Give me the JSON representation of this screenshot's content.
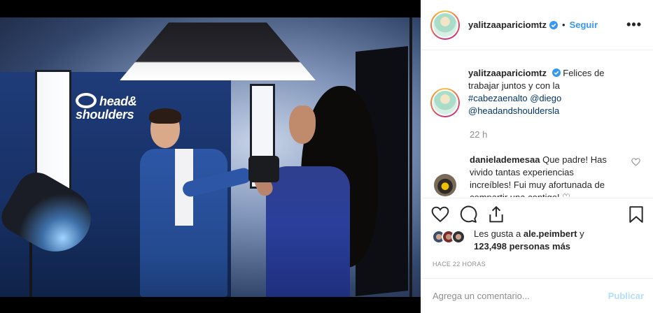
{
  "post": {
    "author": {
      "username": "yalitzaapariciomtz",
      "verified": true,
      "follow_label": "Seguir",
      "separator": "•"
    },
    "photo": {
      "brand_text_line1": "head&",
      "brand_text_line2": "shoulders"
    },
    "caption": {
      "username": "yalitzaapariciomtz",
      "text": "Felices de trabajar juntos y con la",
      "hashtag": "#cabezaenalto",
      "mention1": "@diego",
      "mention2": "@headandshouldersla",
      "time": "22 h"
    },
    "comment": {
      "username": "danielademesaa",
      "text": "Que padre! Has vivido tantas experiencias increíbles! Fui muy afortunada de compartir una contigo! ♡"
    },
    "likes": {
      "prefix": "Les gusta a",
      "user": "ale.peimbert",
      "conj": "y",
      "count": "123,498 personas más"
    },
    "posted": "HACE 22 HORAS",
    "compose": {
      "placeholder": "Agrega un comentario...",
      "publish_label": "Publicar"
    },
    "icons": {
      "more": "more-options-icon",
      "like": "heart-icon",
      "comment": "comment-icon",
      "share": "share-icon",
      "save": "bookmark-icon"
    },
    "colors": {
      "link": "#003569",
      "follow": "#3897f0",
      "muted": "#8e8e8e",
      "publish_disabled": "#b2dffc"
    }
  }
}
